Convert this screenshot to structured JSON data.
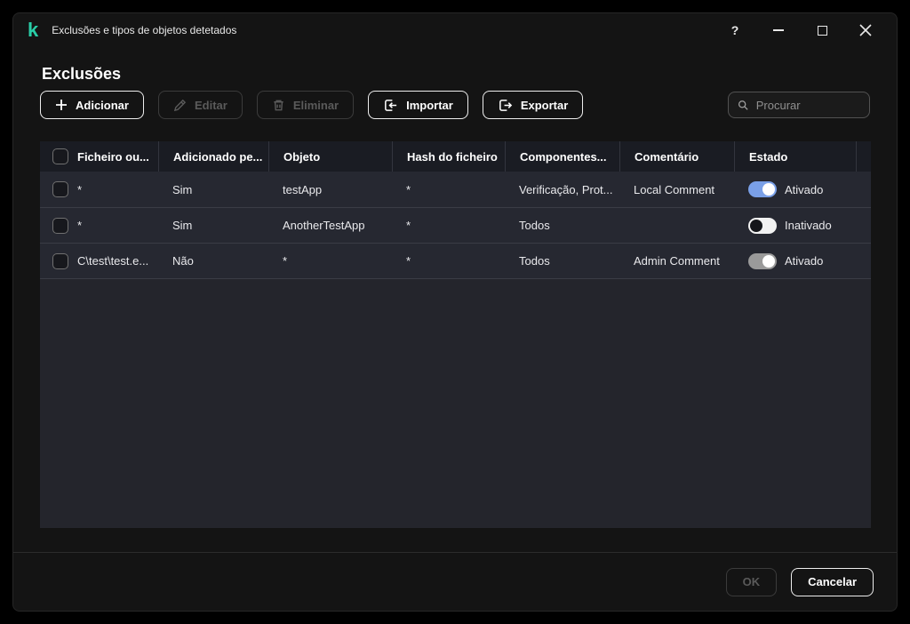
{
  "window": {
    "title": "Exclusões e tipos de objetos detetados",
    "logo_glyph": "k",
    "help_glyph": "?"
  },
  "page": {
    "heading": "Exclusões"
  },
  "toolbar": {
    "add_label": "Adicionar",
    "edit_label": "Editar",
    "delete_label": "Eliminar",
    "import_label": "Importar",
    "export_label": "Exportar",
    "search_placeholder": "Procurar"
  },
  "table": {
    "headers": [
      "Ficheiro ou...",
      "Adicionado pe...",
      "Objeto",
      "Hash do ficheiro",
      "Componentes...",
      "Comentário",
      "Estado"
    ],
    "rows": [
      {
        "file": "*",
        "added_by": "Sim",
        "object": "testApp",
        "hash": "*",
        "components": "Verificação, Prot...",
        "comment": "Local Comment",
        "state": {
          "label": "Ativado",
          "on": true,
          "disabled": false
        }
      },
      {
        "file": "*",
        "added_by": "Sim",
        "object": "AnotherTestApp",
        "hash": "*",
        "components": "Todos",
        "comment": "",
        "state": {
          "label": "Inativado",
          "on": false,
          "disabled": false
        }
      },
      {
        "file": "C\\test\\test.e...",
        "added_by": "Não",
        "object": "*",
        "hash": "*",
        "components": "Todos",
        "comment": "Admin Comment",
        "state": {
          "label": "Ativado",
          "on": true,
          "disabled": true
        }
      }
    ]
  },
  "footer": {
    "ok_label": "OK",
    "cancel_label": "Cancelar"
  },
  "colors": {
    "brand_teal": "#29CDA7",
    "toggle_on": "#7AA0E8",
    "toggle_off_track": "#F2F2F2",
    "toggle_disabled_track": "#9A9A9A",
    "window_bg": "#141414",
    "table_header_bg": "#1A1C23",
    "table_row_bg": "#262831"
  }
}
